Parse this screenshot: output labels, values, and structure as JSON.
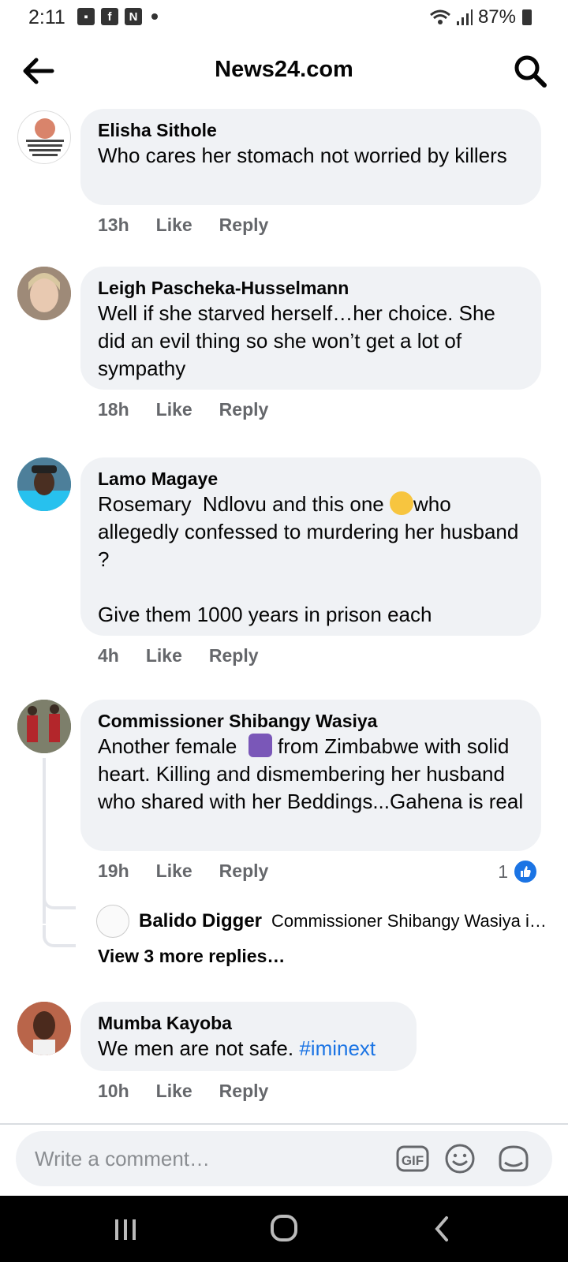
{
  "status_bar": {
    "time": "2:11",
    "battery": "87%",
    "icons": [
      "gallery-icon",
      "facebook-icon",
      "news-icon",
      "notification-dot",
      "wifi-icon",
      "signal-icon",
      "battery-icon"
    ]
  },
  "header": {
    "title": "News24.com"
  },
  "comments": [
    {
      "author": "Elisha Sithole",
      "text": "Who cares her stomach not worried by killers",
      "time": "13h",
      "like_label": "Like",
      "reply_label": "Reply"
    },
    {
      "author": "Leigh Pascheka-Husselmann",
      "text": "Well if she starved herself…her choice. She did an evil thing so she won’t get a lot of sympathy",
      "time": "18h",
      "like_label": "Like",
      "reply_label": "Reply"
    },
    {
      "author": "Lamo Magaye",
      "text_before_emoji": "Rosemary  Ndlovu and this one ",
      "text_after_emoji": "who allegedly confessed to murdering her husband ?\n\nGive them 1000 years in prison each",
      "time": "4h",
      "like_label": "Like",
      "reply_label": "Reply"
    },
    {
      "author": "Commissioner Shibangy Wasiya",
      "text_before_emoji": "Another female ",
      "text_after_emoji": " from Zimbabwe with solid heart. Killing and dismembering her husband who shared with her Beddings...Gahena is real",
      "time": "19h",
      "like_label": "Like",
      "reply_label": "Reply",
      "reaction_count": "1",
      "reply_preview": {
        "author": "Balido Digger",
        "text": "Commissioner Shibangy Wasiya i…"
      },
      "view_more": "View 3 more replies…"
    },
    {
      "author": "Mumba Kayoba",
      "text": "We men are not safe. ",
      "hashtag": "#iminext",
      "time": "10h",
      "like_label": "Like",
      "reply_label": "Reply"
    }
  ],
  "composer": {
    "placeholder": "Write a comment…",
    "gif_label": "GIF"
  },
  "colors": {
    "bubble": "#f0f2f5",
    "link_blue": "#1b74e4",
    "meta_gray": "#65676b"
  }
}
